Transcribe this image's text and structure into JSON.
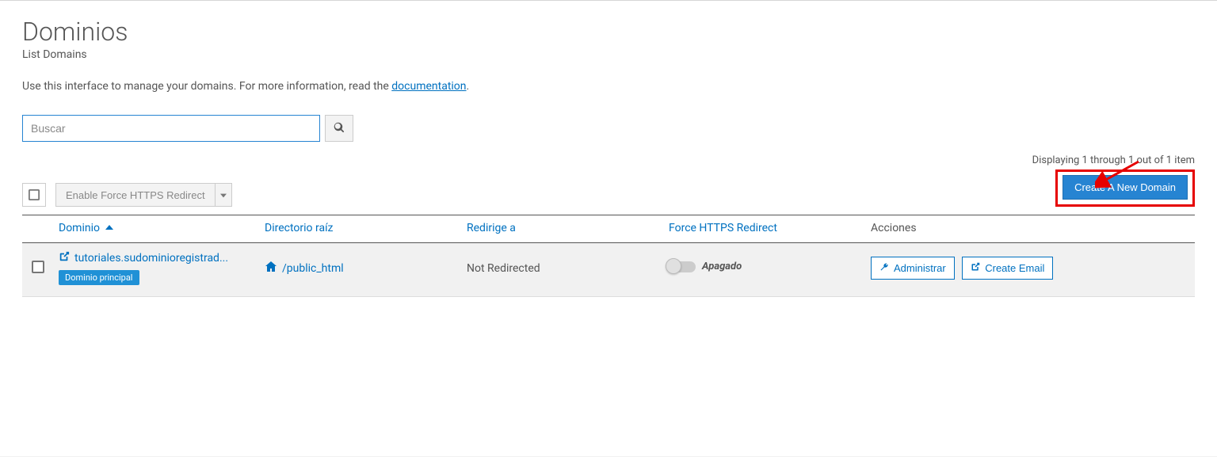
{
  "page": {
    "title": "Dominios",
    "subtitle": "List Domains",
    "description_prefix": "Use this interface to manage your domains. For more information, read the ",
    "documentation_link_text": "documentation",
    "description_suffix": "."
  },
  "search": {
    "placeholder": "Buscar"
  },
  "toolbar": {
    "enable_https_label": "Enable Force HTTPS Redirect",
    "count_text": "Displaying 1 through 1 out of 1 item",
    "create_button_label": "Create A New Domain"
  },
  "table": {
    "headers": {
      "domain": "Dominio",
      "root": "Directorio raíz",
      "redirect": "Redirige a",
      "force_https": "Force HTTPS Redirect",
      "actions": "Acciones"
    },
    "row": {
      "domain_name": "tutoriales.sudominioregistrad...",
      "badge": "Dominio principal",
      "root_dir": "/public_html",
      "redirect_status": "Not Redirected",
      "toggle_label": "Apagado",
      "manage_label": "Administrar",
      "create_email_label": "Create Email"
    }
  }
}
